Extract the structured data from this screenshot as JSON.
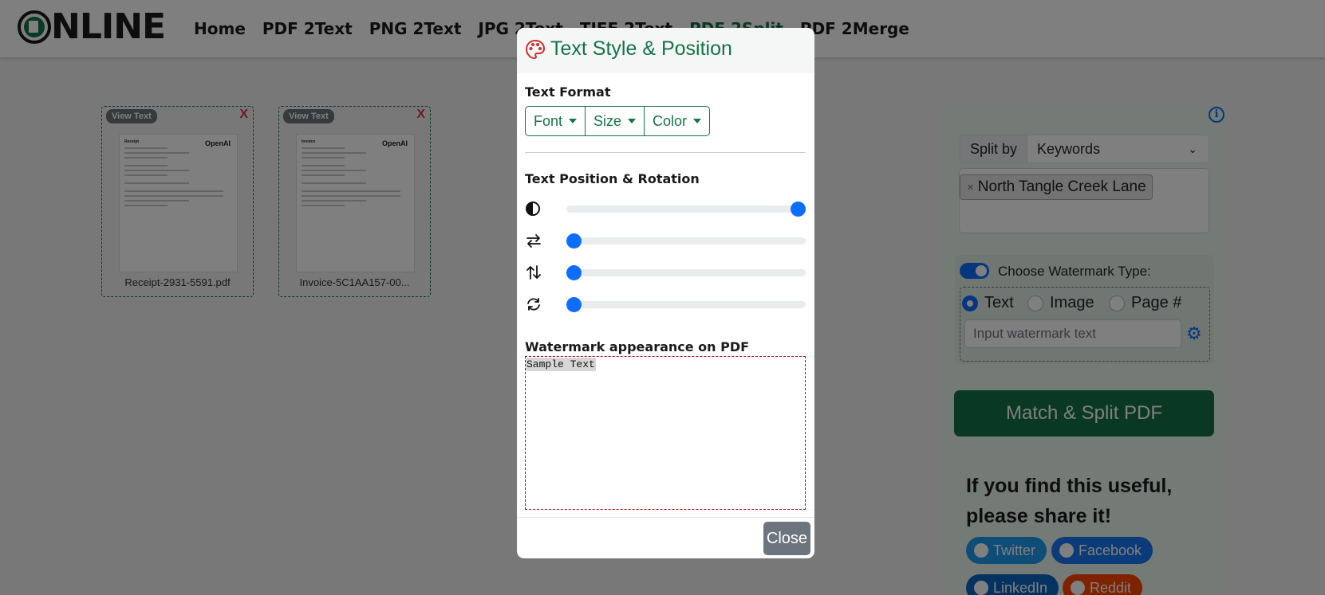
{
  "header": {
    "logo_text": "NLINE",
    "nav": [
      {
        "label": "Home",
        "active": false
      },
      {
        "label": "PDF 2Text",
        "active": false
      },
      {
        "label": "PNG 2Text",
        "active": false
      },
      {
        "label": "JPG 2Text",
        "active": false
      },
      {
        "label": "TIFF 2Text",
        "active": false
      },
      {
        "label": "PDF 2Split",
        "active": true
      },
      {
        "label": "PDF 2Merge",
        "active": false
      }
    ]
  },
  "files": [
    {
      "view_label": "View Text",
      "remove_label": "X",
      "brand": "OpenAI",
      "doc_heading": "Receipt",
      "filename": "Receipt-2931-5591.pdf"
    },
    {
      "view_label": "View Text",
      "remove_label": "X",
      "brand": "OpenAI",
      "doc_heading": "Invoice",
      "filename": "Invoice-5C1AA157-00..."
    }
  ],
  "panel": {
    "info_icon": "info-icon",
    "split_by_label": "Split by",
    "split_by_value": "Keywords",
    "keyword_tag": "North Tangle Creek Lane",
    "tag_remove": "×",
    "watermark_toggle_label": "Choose Watermark Type:",
    "watermark_toggle_on": true,
    "watermark_types": [
      {
        "label": "Text",
        "selected": true
      },
      {
        "label": "Image",
        "selected": false
      },
      {
        "label": "Page #",
        "selected": false
      }
    ],
    "watermark_placeholder": "Input watermark text",
    "match_button": "Match & Split PDF",
    "share_heading": "If you find this useful, please share it!",
    "social": [
      {
        "label": "Twitter",
        "color": "#1d9bf0"
      },
      {
        "label": "Facebook",
        "color": "#1877f2"
      },
      {
        "label": "LinkedIn",
        "color": "#0a66c2"
      },
      {
        "label": "Reddit",
        "color": "#ff4500"
      }
    ]
  },
  "modal": {
    "title": "Text Style & Position",
    "title_icon": "palette-icon",
    "text_format_heading": "Text Format",
    "format_buttons": [
      "Font",
      "Size",
      "Color"
    ],
    "position_heading": "Text Position & Rotation",
    "sliders": [
      {
        "name": "opacity",
        "icon": "contrast-icon",
        "value": 1.0
      },
      {
        "name": "horizontal",
        "icon": "arrows-horizontal-icon",
        "value": 0.0
      },
      {
        "name": "vertical",
        "icon": "arrows-vertical-icon",
        "value": 0.0
      },
      {
        "name": "rotation",
        "icon": "rotate-icon",
        "value": 0.0
      }
    ],
    "preview_heading": "Watermark appearance on PDF",
    "preview_text": "Sample Text",
    "close_label": "Close"
  },
  "colors": {
    "brand_green": "#157347",
    "accent_blue": "#0d6efd",
    "danger_red": "#dc3545"
  }
}
